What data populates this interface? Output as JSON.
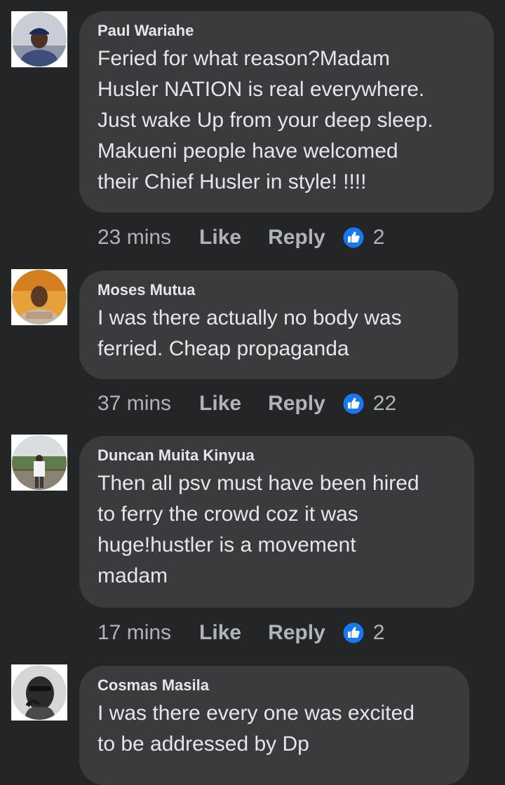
{
  "comments": [
    {
      "author": "Paul Wariahe",
      "text": "Feried for what reason?Madam\nHusler NATION is real everywhere.\nJust wake Up from your deep sleep.\nMakueni people have welcomed\ntheir Chief Husler in style! !!!!",
      "time": "23 mins",
      "like_label": "Like",
      "reply_label": "Reply",
      "reaction_icon": "thumbs-up-icon",
      "reaction_count": "2"
    },
    {
      "author": "Moses Mutua",
      "text": "I was there actually no body was\nferried. Cheap propaganda",
      "time": "37 mins",
      "like_label": "Like",
      "reply_label": "Reply",
      "reaction_icon": "thumbs-up-icon",
      "reaction_count": "22"
    },
    {
      "author": "Duncan Muita Kinyua",
      "text": "Then all psv must have been hired\nto ferry the crowd coz it was\nhuge!hustler is a movement\nmadam",
      "time": "17 mins",
      "like_label": "Like",
      "reply_label": "Reply",
      "reaction_icon": "thumbs-up-icon",
      "reaction_count": "2"
    },
    {
      "author": "Cosmas Masila",
      "text": "I was there every one was excited\nto be addressed by Dp"
    }
  ],
  "colors": {
    "background": "#242526",
    "bubble": "#3a3b3c",
    "text": "#e4e6eb",
    "secondary_text": "#b0b3b8",
    "like_blue": "#1877f2"
  }
}
